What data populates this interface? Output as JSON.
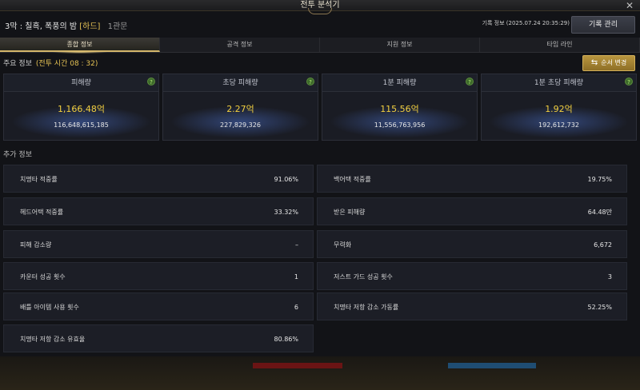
{
  "window": {
    "title": "전투 분석기"
  },
  "header": {
    "stage": "3막 : 칠흑, 폭풍의 밤",
    "difficulty": "[하드]",
    "gate": "1관문",
    "record_time": "기록 정보 (2025.07.24 20:35:29)",
    "record_button": "기록 관리"
  },
  "tabs": [
    "종합 정보",
    "공격 정보",
    "지원 정보",
    "타임 라인"
  ],
  "main_info": {
    "label": "주요 정보",
    "battle_time": "(전투 시간 08 : 32)",
    "order_button": "순서 변경"
  },
  "cards": [
    {
      "title": "피해량",
      "big": "1,166.48억",
      "small": "116,648,615,185"
    },
    {
      "title": "초당 피해량",
      "big": "2.27억",
      "small": "227,829,326"
    },
    {
      "title": "1분 피해량",
      "big": "115.56억",
      "small": "11,556,763,956"
    },
    {
      "title": "1분 초당 피해량",
      "big": "1.92억",
      "small": "192,612,732"
    }
  ],
  "extra_info": {
    "label": "추가 정보",
    "left": [
      {
        "label": "치명타 적중률",
        "value": "91.06%"
      },
      {
        "label": "헤드어택 적중률",
        "value": "33.32%"
      },
      {
        "label": "피해 감소량",
        "value": "–"
      },
      {
        "label": "카운터 성공 횟수",
        "value": "1"
      },
      {
        "label": "배틀 아이템 사용 횟수",
        "value": "6"
      },
      {
        "label": "치명타 저항 감소 유효율",
        "value": "80.86%"
      }
    ],
    "right": [
      {
        "label": "백어택 적중률",
        "value": "19.75%"
      },
      {
        "label": "받은 피해량",
        "value": "64.48만"
      },
      {
        "label": "무력화",
        "value": "6,672"
      },
      {
        "label": "저스트 가드 성공 횟수",
        "value": "3"
      },
      {
        "label": "치명타 저항 감소 가동률",
        "value": "52.25%"
      }
    ]
  },
  "icons": {
    "help": "help-icon",
    "close": "close-icon",
    "swap": "swap-icon"
  },
  "colors": {
    "accent_gold": "#e5c254",
    "button_gold": "#b8953f"
  }
}
